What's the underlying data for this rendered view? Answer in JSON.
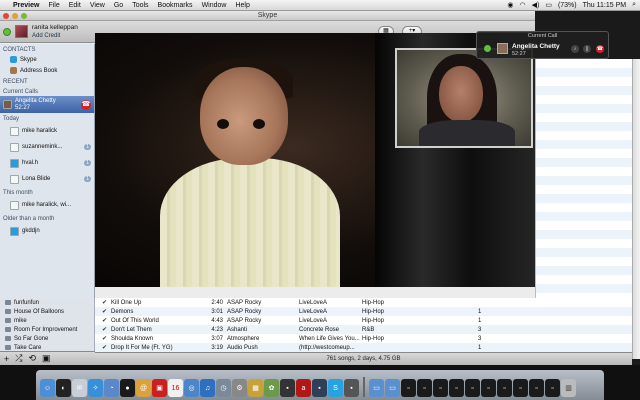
{
  "menubar": {
    "apple": "",
    "app": "Preview",
    "items": [
      "File",
      "Edit",
      "View",
      "Go",
      "Tools",
      "Bookmarks",
      "Window",
      "Help"
    ],
    "battery": "(73%)",
    "clock": "Thu 11:15 PM"
  },
  "skype": {
    "title": "Skype",
    "user": {
      "name": "ranita kelleppan",
      "credit": "Add Credit"
    },
    "sections": {
      "contacts": "CONTACTS",
      "recent": "RECENT",
      "current_calls": "Current Calls",
      "today": "Today",
      "this_month": "This month",
      "older": "Older than a month"
    },
    "contacts": [
      {
        "label": "Skype"
      },
      {
        "label": "Address Book"
      }
    ],
    "current_call": {
      "name": "Angelita Chetty",
      "time": "52:27"
    },
    "today": [
      {
        "label": "mike haralick",
        "badge": ""
      },
      {
        "label": "suzannemink...",
        "badge": "1"
      },
      {
        "label": "hval.h",
        "badge": "1"
      },
      {
        "label": "Lona Blide",
        "badge": "1"
      }
    ],
    "month": [
      {
        "label": "mike haralick, wi..."
      }
    ],
    "older": [
      {
        "label": "gkddjn"
      }
    ],
    "hud": {
      "title": "Current Call",
      "name": "Angelita Chetty",
      "time": "52:27"
    }
  },
  "itunes": {
    "playlists": [
      {
        "label": "funfunfun"
      },
      {
        "label": "House Of Balloons"
      },
      {
        "label": "mike"
      },
      {
        "label": "Room For Improvement"
      },
      {
        "label": "So Far Gone"
      },
      {
        "label": "Take Care"
      }
    ],
    "tracks": [
      {
        "name": "Kill One Up",
        "time": "2:40",
        "artist": "ASAP Rocky",
        "album": "LiveLoveA",
        "genre": "Hip-Hop",
        "plays": ""
      },
      {
        "name": "Demons",
        "time": "3:01",
        "artist": "ASAP Rocky",
        "album": "LiveLoveA",
        "genre": "Hip-Hop",
        "plays": "1"
      },
      {
        "name": "Out Of This World",
        "time": "4:43",
        "artist": "ASAP Rocky",
        "album": "LiveLoveA",
        "genre": "Hip-Hop",
        "plays": "1"
      },
      {
        "name": "Don't Let Them",
        "time": "4:23",
        "artist": "Ashanti",
        "album": "Concrete Rose",
        "genre": "R&B",
        "plays": "3"
      },
      {
        "name": "Shoulda Known",
        "time": "3:07",
        "artist": "Atmosphere",
        "album": "When Life Gives You...",
        "genre": "Hip-Hop",
        "plays": "3"
      },
      {
        "name": "Drop It For Me (Ft. YG)",
        "time": "3:19",
        "artist": "Audio Push",
        "album": "(http://westcomeup...",
        "genre": "",
        "plays": "1"
      }
    ],
    "status": "761 songs, 2 days, 4.75 GB"
  },
  "colors": {
    "skype_green": "#5fc13b",
    "hangup_red": "#d5222a",
    "selection_blue": "#4a6fb0"
  }
}
